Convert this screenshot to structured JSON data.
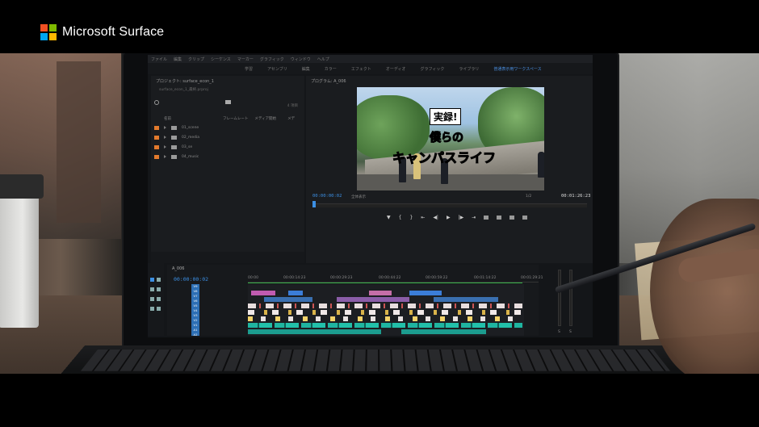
{
  "brand": {
    "name": "Microsoft Surface",
    "logo_colors": [
      "#f25022",
      "#7fba00",
      "#00a4ef",
      "#ffb900"
    ]
  },
  "editor": {
    "menu": [
      "ファイル",
      "編集",
      "クリップ",
      "シーケンス",
      "マーカー",
      "グラフィック",
      "ウィンドウ",
      "ヘルプ"
    ],
    "workspaces": [
      "学習",
      "アセンブリ",
      "編集",
      "カラー",
      "エフェクト",
      "オーディオ",
      "グラフィック",
      "ライブラリ",
      "普通表示用ワークスペース"
    ],
    "project_panel": {
      "title": "プロジェクト: surface_econ_1",
      "path": "surface_econ_1_最終.prproj",
      "count": "4 項目",
      "columns": [
        "名前",
        "フレームレート",
        "メディア開始",
        "メデ"
      ],
      "bins": [
        "01_scene",
        "02_media",
        "03_se",
        "04_music"
      ]
    },
    "program_monitor": {
      "title": "プログラム: A_006",
      "title_card": {
        "line1": "実録!",
        "line2": "僕らの",
        "line3": "キャンパスライフ"
      },
      "timecode_current": "00:00:00:02",
      "fit_label": "全体表示",
      "resolution": "1/2",
      "timecode_duration": "00:01:26:23"
    },
    "timeline": {
      "sequence_name": "A_006",
      "timecode": "00:00:00:02",
      "ruler_marks": [
        "00:00",
        "00:00:14:23",
        "00:00:29:23",
        "00:00:44:22",
        "00:00:59:22",
        "00:01:14:22",
        "00:01:29:21"
      ],
      "video_tracks": [
        "V9",
        "V8",
        "V7",
        "V6",
        "V5",
        "V4",
        "V3",
        "V2",
        "V1"
      ],
      "audio_tracks": [
        "A1",
        "A2"
      ]
    },
    "meter_labels": [
      "S",
      "S"
    ]
  }
}
